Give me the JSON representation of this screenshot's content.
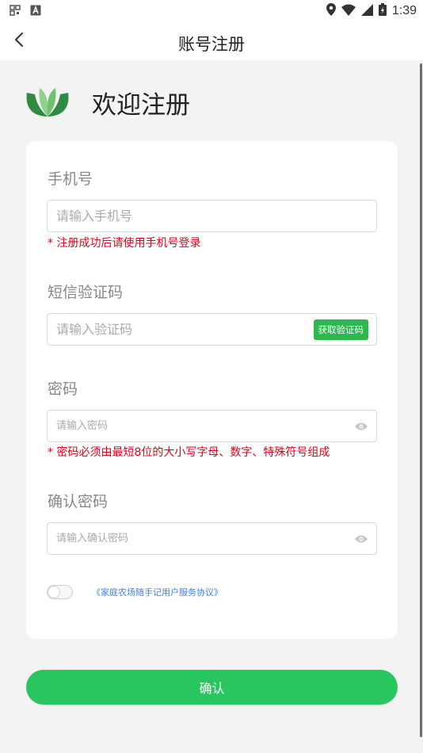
{
  "status_bar": {
    "time": "1:39",
    "icons": [
      "qr-code-icon",
      "a-box-icon",
      "location-icon",
      "wifi-icon",
      "signal-icon",
      "battery-icon"
    ]
  },
  "header": {
    "title": "账号注册",
    "back_icon": "chevron-left-icon"
  },
  "welcome": {
    "title": "欢迎注册",
    "logo": "book-leaf-logo"
  },
  "form": {
    "phone": {
      "label": "手机号",
      "placeholder": "请输入手机号",
      "value": "",
      "hint": "* 注册成功后请使用手机号登录"
    },
    "sms_code": {
      "label": "短信验证码",
      "placeholder": "请输入验证码",
      "value": "",
      "button": "获取验证码"
    },
    "password": {
      "label": "密码",
      "placeholder": "请输入密码",
      "value": "",
      "hint": "* 密码必须由最短8位的大小写字母、数字、特殊符号组成"
    },
    "confirm_password": {
      "label": "确认密码",
      "placeholder": "请输入确认密码",
      "value": ""
    },
    "agreement": {
      "text": "《家庭农场随手记用户服务协议》",
      "checked": false
    }
  },
  "confirm_button": "确认",
  "colors": {
    "accent_green": "#29c660",
    "sms_button_green": "#2db84e",
    "error_red": "#e4001b",
    "link_blue": "#3d82f5",
    "background": "#f3f3f3"
  }
}
